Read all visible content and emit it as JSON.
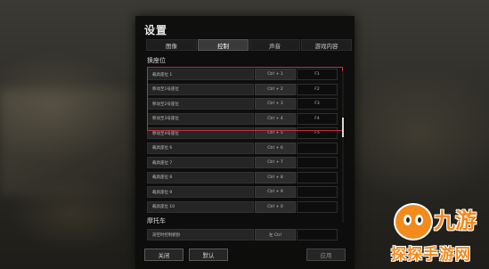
{
  "window": {
    "title": "设置"
  },
  "tabs": [
    {
      "label": "图像"
    },
    {
      "label": "控制",
      "active": true
    },
    {
      "label": "声音"
    },
    {
      "label": "游戏内容"
    }
  ],
  "sections": {
    "seats": "换座位",
    "motorcycle": "摩托车"
  },
  "bindings": [
    {
      "label": "载具座位 1",
      "key1": "Ctrl + 1",
      "key2": "F1"
    },
    {
      "label": "移动至1号座位",
      "key1": "Ctrl + 2",
      "key2": "F2"
    },
    {
      "label": "移动至2号座位",
      "key1": "Ctrl + 3",
      "key2": "F3"
    },
    {
      "label": "移动至3号座位",
      "key1": "Ctrl + 4",
      "key2": "F4"
    },
    {
      "label": "移动至4号座位",
      "key1": "Ctrl + 5",
      "key2": "F5"
    },
    {
      "label": "载具座位 6",
      "key1": "Ctrl + 6",
      "key2": ""
    },
    {
      "label": "载具座位 7",
      "key1": "Ctrl + 7",
      "key2": ""
    },
    {
      "label": "载具座位 8",
      "key1": "Ctrl + 8",
      "key2": ""
    },
    {
      "label": "载具座位 9",
      "key1": "Ctrl + 9",
      "key2": ""
    },
    {
      "label": "载具座位 10",
      "key1": "Ctrl + 0",
      "key2": ""
    }
  ],
  "motorcycle_bindings": [
    {
      "label": "滞空时控制俯卧",
      "key1": "左 Ctrl",
      "key2": ""
    }
  ],
  "buttons": {
    "close": "关闭",
    "default": "默认",
    "apply": "应用"
  },
  "watermark": {
    "big": "九游",
    "sub": "探探手游网"
  },
  "colors": {
    "highlight": "#c0303a",
    "logo": "#f28a1c"
  }
}
